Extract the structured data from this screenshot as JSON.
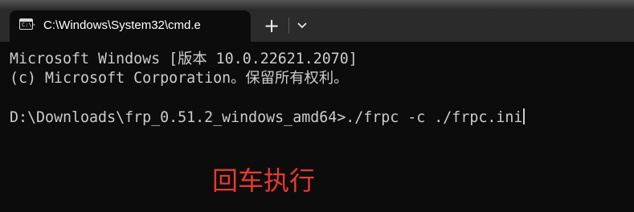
{
  "tab": {
    "title": "C:\\Windows\\System32\\cmd.e",
    "icon": "terminal-icon",
    "icon_prompt": "C:\\>"
  },
  "toolbar": {
    "new_tab_label": "+",
    "new_tab_icon": "plus-icon",
    "dropdown_icon": "chevron-down-icon"
  },
  "terminal": {
    "lines": [
      "Microsoft Windows [版本 10.0.22621.2070]",
      "(c) Microsoft Corporation。保留所有权利。",
      "",
      "D:\\Downloads\\frp_0.51.2_windows_amd64>./frpc -c ./frpc.ini"
    ],
    "text_color": "#cccccc",
    "background": "#0c0c0c"
  },
  "annotation": {
    "text": "回车执行",
    "color": "#e53a30"
  }
}
